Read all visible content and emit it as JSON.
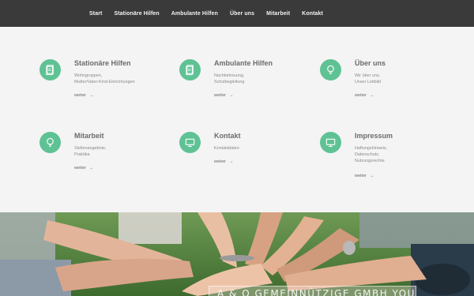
{
  "nav": {
    "items": [
      {
        "label": "Start"
      },
      {
        "label": "Stationäre Hilfen"
      },
      {
        "label": "Ambulante Hilfen"
      },
      {
        "label": "Über uns"
      },
      {
        "label": "Mitarbeit"
      },
      {
        "label": "Kontakt"
      }
    ]
  },
  "cards": [
    {
      "title": "Stationäre Hilfen",
      "lines": [
        "Wohngruppen,",
        "Mutter/Vater-Kind-Einrichtungen"
      ],
      "more": "weiter",
      "arrow": "→",
      "icon": "document-icon"
    },
    {
      "title": "Ambulante Hilfen",
      "lines": [
        "Nachbetreuung,",
        "Schulbegleitung"
      ],
      "more": "weiter",
      "arrow": "→",
      "icon": "document-icon"
    },
    {
      "title": "Über uns",
      "lines": [
        "Wir über uns,",
        "Unser Leitbild"
      ],
      "more": "weiter",
      "arrow": "→",
      "icon": "lightbulb-icon"
    },
    {
      "title": "Mitarbeit",
      "lines": [
        "Stellenangebote,",
        "Praktika"
      ],
      "more": "weiter",
      "arrow": "→",
      "icon": "lightbulb-icon"
    },
    {
      "title": "Kontakt",
      "lines": [
        "Kontaktdaten"
      ],
      "more": "weiter",
      "arrow": "→",
      "icon": "monitor-icon"
    },
    {
      "title": "Impressum",
      "lines": [
        "Haftungshinweis,",
        "Datenschutz,",
        "Nutzungsrechte"
      ],
      "more": "weiter",
      "arrow": "→",
      "icon": "monitor-icon"
    }
  ],
  "banner": {
    "text": "A & O GEMEINNÜTZIGE GMBH YOU"
  },
  "colors": {
    "accent": "#5fc294",
    "nav_bg": "#3a3a3a",
    "page_bg": "#f4f4f4"
  }
}
